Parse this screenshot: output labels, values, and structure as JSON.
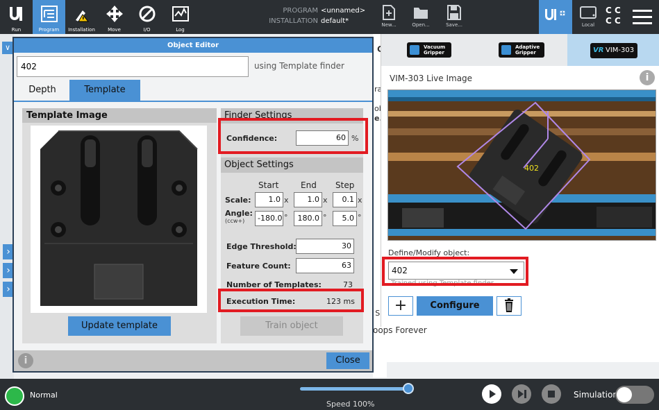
{
  "topbar": {
    "nav": [
      {
        "label": "Run",
        "icon": "ur-logo-icon"
      },
      {
        "label": "Program",
        "icon": "program-icon"
      },
      {
        "label": "Installation",
        "icon": "installation-icon"
      },
      {
        "label": "Move",
        "icon": "move-icon"
      },
      {
        "label": "I/O",
        "icon": "io-icon"
      },
      {
        "label": "Log",
        "icon": "log-icon"
      }
    ],
    "program_key": "PROGRAM",
    "program_value": "<unnamed>",
    "installation_key": "INSTALLATION",
    "installation_value": "default*",
    "new_label": "New...",
    "open_label": "Open...",
    "save_label": "Save...",
    "local_label": "Local",
    "cc_text": "C C\nC C"
  },
  "right_panel": {
    "tabs": [
      {
        "label": "Vacuum Gripper"
      },
      {
        "label": "Adaptive Gripper"
      },
      {
        "label": "VIM-303"
      }
    ],
    "live_title": "VIM-303 Live Image",
    "detected_label": "402",
    "define_label": "Define/Modify object:",
    "selected_object": "402",
    "hidden_text": "Trained using Template finder",
    "configure_label": "Configure"
  },
  "background_program": {
    "frag_g": "G",
    "frag_ra": "ra",
    "frag_ob": "ob",
    "frag_e": "e.",
    "frag_s": "e S",
    "loops": "oops Forever"
  },
  "dialog": {
    "title": "Object Editor",
    "object_name": "402",
    "finder_text": "using Template finder",
    "tabs": {
      "depth": "Depth",
      "template": "Template"
    },
    "template_image_title": "Template Image",
    "update_label": "Update template",
    "finder_settings_title": "Finder Settings",
    "confidence_label": "Confidence:",
    "confidence_value": "60",
    "confidence_unit": "%",
    "object_settings_title": "Object Settings",
    "col_start": "Start",
    "col_end": "End",
    "col_step": "Step",
    "scale_label": "Scale:",
    "scale_start": "1.0",
    "scale_end": "1.0",
    "scale_step": "0.1",
    "scale_unit": "x",
    "angle_label": "Angle:",
    "angle_sub": "(ccw+)",
    "angle_start": "-180.0",
    "angle_end": "180.0",
    "angle_step": "5.0",
    "angle_unit": "°",
    "edge_label": "Edge Threshold:",
    "edge_value": "30",
    "feature_label": "Feature Count:",
    "feature_value": "63",
    "num_templates_label": "Number of Templates:",
    "num_templates_value": "73",
    "exec_label": "Execution Time:",
    "exec_value": "123 ms",
    "train_label": "Train object",
    "close_label": "Close"
  },
  "bottombar": {
    "status": "Normal",
    "speed": "Speed 100%",
    "speed_fraction": 1.0,
    "simulation_label": "Simulation"
  },
  "colors": {
    "accent": "#4a91d4",
    "highlight": "#e21b22",
    "status_ok": "#2db84a"
  }
}
